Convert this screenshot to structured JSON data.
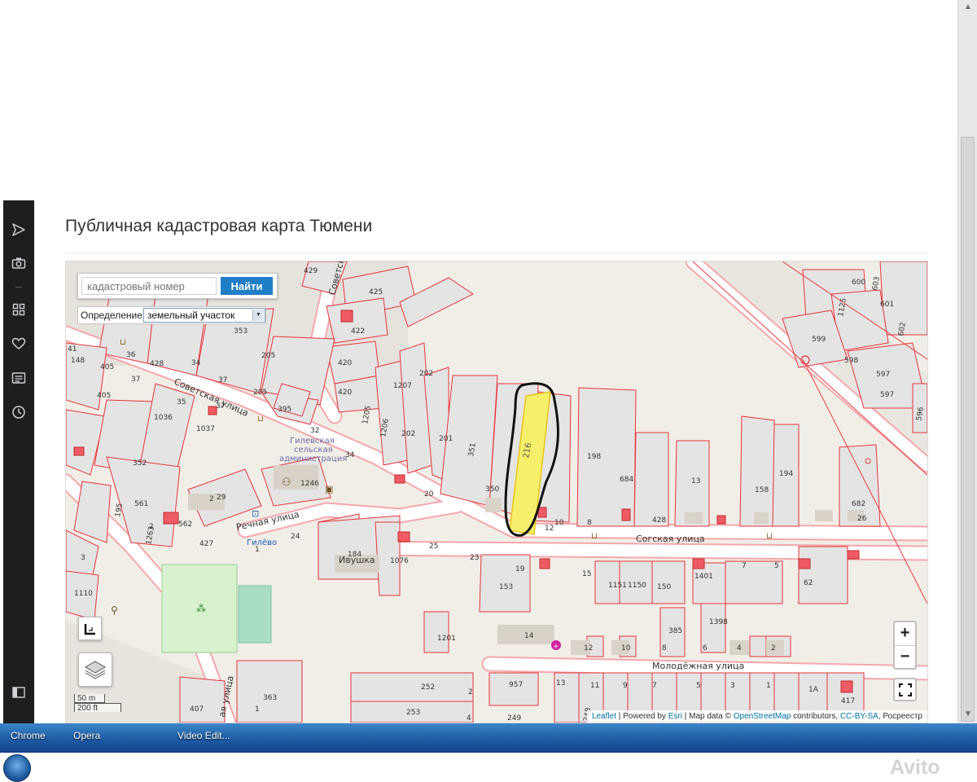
{
  "page": {
    "title": "Публичная кадастровая карта Тюмени"
  },
  "search": {
    "placeholder": "кадастровый номер",
    "button_label": "Найти"
  },
  "definition": {
    "label": "Определение:",
    "selected": "земельный участок"
  },
  "zoom": {
    "plus": "+",
    "minus": "−"
  },
  "scale": {
    "metric": "50 m",
    "imperial": "200 ft"
  },
  "attribution": {
    "leaflet": "Leaflet",
    "sep1": " | Powered by ",
    "esri": "Esri",
    "sep2": " | Map data © ",
    "osm": "OpenStreetMap",
    "sep3": " contributors, ",
    "license": "CC-BY-SA",
    "sep4": ", Росреестр"
  },
  "map": {
    "streets": [
      "Советская улица",
      "Речная улица",
      "Советская улица",
      "Молодёжная улица",
      "ая улица"
    ],
    "places": [
      "Гилевская сельская администрация",
      "Гилёво",
      "Ивушка"
    ],
    "highlighted_parcel": "216",
    "parcel_labels": [
      "429",
      "425",
      "422",
      "420",
      "420",
      "1",
      "1207",
      "1207",
      "202",
      "205",
      "353",
      "205",
      "395",
      "428",
      "36",
      "34",
      "37",
      "405",
      "39",
      "37",
      "405",
      "148",
      "41",
      "35",
      "1036",
      "1037",
      "32",
      "37",
      "382",
      "1205",
      "1206",
      "202",
      "201",
      "351",
      "350",
      "216",
      "198",
      "684",
      "13",
      "158",
      "194",
      "682",
      "26",
      "352",
      "352",
      "561",
      "195",
      "562",
      "29",
      "2",
      "1246",
      "24",
      "184",
      "1076",
      "25",
      "23",
      "427",
      "1263",
      "184",
      "1110",
      "3",
      "19",
      "153",
      "15",
      "1151",
      "1150",
      "150",
      "1401",
      "7",
      "5",
      "62",
      "1201",
      "14",
      "385",
      "1398",
      "12",
      "10",
      "8",
      "6",
      "4",
      "2",
      "252",
      "2",
      "957",
      "13",
      "11",
      "9",
      "7",
      "5",
      "3",
      "1",
      "1А",
      "417",
      "363",
      "253",
      "4",
      "249",
      "248",
      "407",
      "1",
      "600",
      "601",
      "603",
      "1125",
      "599",
      "598",
      "597",
      "597",
      "602",
      "60",
      "60",
      "596",
      "10",
      "8",
      "12"
    ],
    "colors": {
      "parcel_outline": "#e8333a",
      "parcel_fill": "#e4e4e4",
      "road": "#ffffff",
      "background": "#f1eee7",
      "highlight": "#f5ef6b",
      "building": "#d9d2c8",
      "small_building": "#ef5b63",
      "park": "#d8f2d0",
      "pitch": "#a9dec2"
    }
  },
  "taskbar": {
    "items": [
      "Chrome",
      "Opera",
      "Video Edit..."
    ],
    "watermark": "Avito"
  }
}
